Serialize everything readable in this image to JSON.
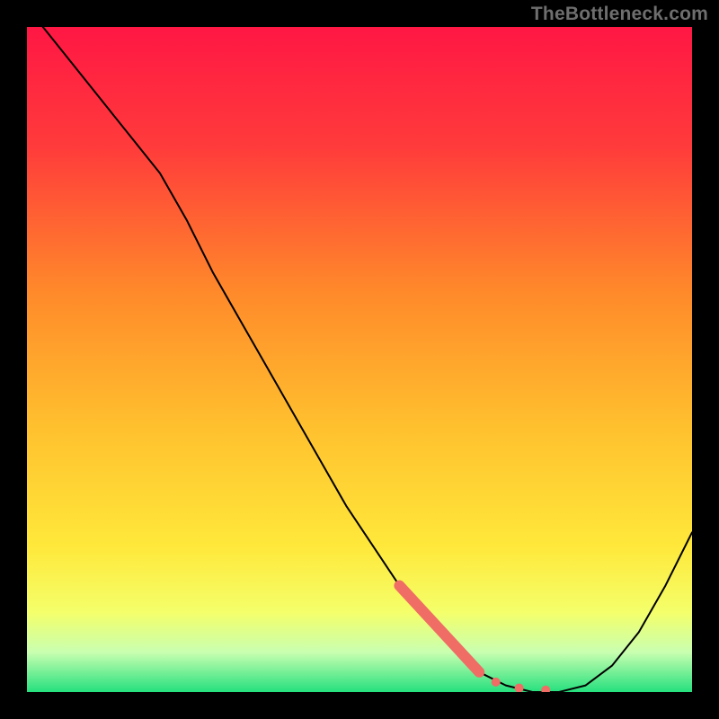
{
  "watermark": "TheBottleneck.com",
  "colors": {
    "gradient_stops": [
      {
        "offset": "0%",
        "color": "#ff1744"
      },
      {
        "offset": "18%",
        "color": "#ff3b3b"
      },
      {
        "offset": "40%",
        "color": "#ff8a2a"
      },
      {
        "offset": "60%",
        "color": "#ffc02e"
      },
      {
        "offset": "78%",
        "color": "#ffe83a"
      },
      {
        "offset": "88%",
        "color": "#f4ff6a"
      },
      {
        "offset": "94%",
        "color": "#c9ffb0"
      },
      {
        "offset": "100%",
        "color": "#25e07e"
      }
    ],
    "curve_stroke": "#000000",
    "marker_fill": "#ef6d65",
    "frame_bg": "#000000"
  },
  "chart_data": {
    "type": "line",
    "title": "",
    "xlabel": "",
    "ylabel": "",
    "xlim": [
      0,
      100
    ],
    "ylim": [
      0,
      100
    ],
    "grid": false,
    "legend": false,
    "series": [
      {
        "name": "bottleneck-curve",
        "x": [
          0,
          4,
          8,
          12,
          16,
          20,
          24,
          28,
          32,
          36,
          40,
          44,
          48,
          52,
          56,
          60,
          64,
          68,
          72,
          76,
          80,
          84,
          88,
          92,
          96,
          100
        ],
        "y": [
          103,
          98,
          93,
          88,
          83,
          78,
          71,
          63,
          56,
          49,
          42,
          35,
          28,
          22,
          16,
          11,
          7,
          3,
          1,
          0,
          0,
          1,
          4,
          9,
          16,
          24
        ]
      }
    ],
    "markers": {
      "name": "critical-region",
      "color": "#ef6d65",
      "segment": {
        "x1": 56,
        "y1": 16,
        "x2": 68,
        "y2": 3,
        "width": 12
      },
      "dots": [
        {
          "x": 70.5,
          "y": 1.5,
          "r": 5
        },
        {
          "x": 74,
          "y": 0.6,
          "r": 5
        },
        {
          "x": 78,
          "y": 0.3,
          "r": 5
        }
      ]
    }
  }
}
